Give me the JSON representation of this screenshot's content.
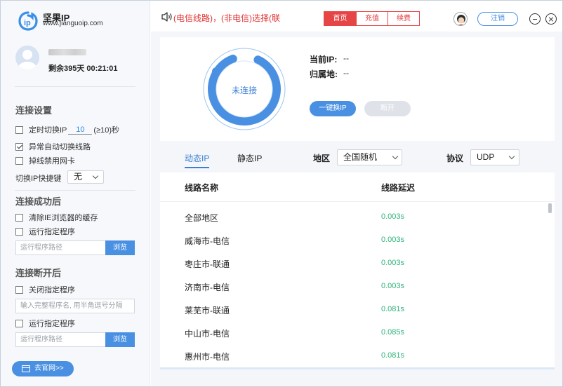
{
  "app": {
    "name": "坚果IP",
    "url": "www.jianguoip.com"
  },
  "account": {
    "remaining": "剩余395天 00:21:01"
  },
  "notice": {
    "text": "(电信线路)，(非电信)选择(联"
  },
  "nav": {
    "tabs": [
      {
        "label": "首页",
        "active": true
      },
      {
        "label": "充值",
        "active": false
      },
      {
        "label": "续费",
        "active": false
      }
    ],
    "logout_label": "注销"
  },
  "settings": {
    "connect_title": "连接设置",
    "timed_switch_prefix": "定时切换IP",
    "timed_switch_value": "10",
    "timed_switch_suffix": "(≥10)秒",
    "auto_switch_label": "异常自动切换线路",
    "disable_nic_label": "掉线禁用网卡",
    "hotkey_label": "切换IP快捷键",
    "hotkey_value": "无",
    "after_connect_title": "连接成功后",
    "clear_cache_label": "清除IE浏览器的缓存",
    "run_program_label": "运行指定程序",
    "program_path_placeholder": "运行程序路径",
    "browse_label": "浏览",
    "after_disconnect_title": "连接断开后",
    "close_program_label": "关闭指定程序",
    "close_program_placeholder": "输入完整程序名, 用半角逗号分隔",
    "run_program_label_2": "运行指定程序",
    "program_path_placeholder_2": "运行程序路径",
    "browse_label_2": "浏览",
    "website_label": "去官网>>"
  },
  "status": {
    "state_label": "未连接",
    "current_ip_label": "当前IP:",
    "current_ip_value": "--",
    "location_label": "归属地:",
    "location_value": "--",
    "change_ip_label": "一键换IP",
    "disconnect_label": "断开"
  },
  "filters": {
    "tab_dynamic": "动态IP",
    "tab_static": "静态IP",
    "region_label": "地区",
    "region_value": "全国随机",
    "protocol_label": "协议",
    "protocol_value": "UDP"
  },
  "table": {
    "col_name": "线路名称",
    "col_latency": "线路延迟",
    "rows": [
      {
        "name": "全部地区",
        "latency": "0.003s"
      },
      {
        "name": "威海市-电信",
        "latency": "0.003s"
      },
      {
        "name": "枣庄市-联通",
        "latency": "0.003s"
      },
      {
        "name": "济南市-电信",
        "latency": "0.003s"
      },
      {
        "name": "莱芜市-联通",
        "latency": "0.081s"
      },
      {
        "name": "中山市-电信",
        "latency": "0.085s"
      },
      {
        "name": "惠州市-电信",
        "latency": "0.081s"
      }
    ]
  },
  "colors": {
    "accent": "#4a90e2",
    "nav_red": "#e64545",
    "latency_green": "#2fb37a",
    "notice_red": "#e03030"
  }
}
